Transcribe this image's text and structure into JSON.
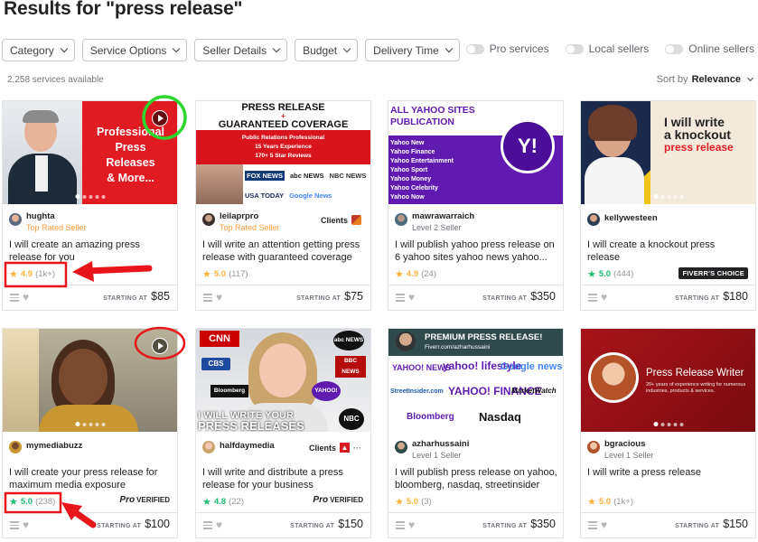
{
  "page": {
    "title": "Results for \"press release\""
  },
  "filters": [
    "Category",
    "Service Options",
    "Seller Details",
    "Budget",
    "Delivery Time"
  ],
  "toggles": [
    "Pro services",
    "Local sellers",
    "Online sellers"
  ],
  "results": {
    "count": "2,258 services available",
    "sort_label": "Sort by",
    "sort_value": "Relevance"
  },
  "footer": {
    "starting_label": "STARTING AT"
  },
  "cards": [
    {
      "seller": "hughta",
      "level": "Top Rated Seller",
      "title": "I will create an amazing press release for you",
      "score": "4.9",
      "reviews": "(1k+)",
      "price": "$85",
      "star": "gold",
      "badge": "",
      "thumb": {
        "line1": "Professional",
        "line2": "Press",
        "line3": "Releases",
        "line4": "& More..."
      }
    },
    {
      "seller": "leilaprpro",
      "level": "Top Rated Seller",
      "clients": "Clients",
      "title": "I will write an attention getting press release with guaranteed coverage",
      "score": "5.0",
      "reviews": "(117)",
      "price": "$75",
      "star": "gold",
      "badge": "",
      "thumb": {
        "line1": "PRESS RELEASE",
        "line2": "GUARANTEED COVERAGE",
        "line3": "Public Relations Professional",
        "line4": "15 Years Experience",
        "line5": "170+ 5 Star Reviews",
        "logos": [
          "FOX NEWS",
          "abc NEWS",
          "NBC NEWS",
          "USA TODAY",
          "Google News"
        ]
      }
    },
    {
      "seller": "mawrawarraich",
      "level": "Level 2 Seller",
      "title": "I will publish yahoo press release on 6 yahoo sites yahoo news yahoo...",
      "score": "4.9",
      "reviews": "(24)",
      "price": "$350",
      "star": "gold",
      "badge": "",
      "thumb": {
        "line1": "ALL YAHOO SITES",
        "line2": "PUBLICATION",
        "list": [
          "Yahoo New",
          "Yahoo Finance",
          "Yahoo Entertainment",
          "Yahoo Sport",
          "Yahoo Money",
          "Yahoo Celebrity",
          "Yahoo Now"
        ],
        "logo": "Y!"
      }
    },
    {
      "seller": "kellywesteen",
      "level": "",
      "title": "I will create a knockout press release",
      "score": "5.0",
      "reviews": "(444)",
      "price": "$180",
      "star": "teal",
      "badge": "FIVERR'S CHOICE",
      "thumb": {
        "line1": "I will write",
        "line2": "a knockout",
        "line3": "press release"
      }
    },
    {
      "seller": "mymediabuzz",
      "level": "",
      "title": "I will create your press release for maximum media exposure",
      "score": "5.0",
      "reviews": "(238)",
      "price": "$100",
      "star": "teal",
      "badge": "Pro VERIFIED",
      "badge_pro": "Pro",
      "badge_verified": "VERIFIED",
      "thumb": {}
    },
    {
      "seller": "halfdaymedia",
      "level": "",
      "clients": "Clients",
      "title": "I will write and distribute a press release for your business",
      "score": "4.8",
      "reviews": "(22)",
      "price": "$150",
      "star": "teal",
      "badge": "Pro VERIFIED",
      "badge_pro": "Pro",
      "badge_verified": "VERIFIED",
      "thumb": {
        "line1": "I WILL WRITE YOUR",
        "line2": "PRESS RELEASES",
        "logos": [
          "CNN",
          "abc NEWS",
          "CBS",
          "BBC NEWS",
          "Bloomberg",
          "YAHOO!",
          "NBC"
        ]
      }
    },
    {
      "seller": "azharhussaini",
      "level": "Level 1 Seller",
      "title": "I will publish press release on yahoo, bloomberg, nasdaq, streetinsider",
      "score": "5.0",
      "reviews": "(3)",
      "price": "$350",
      "star": "gold",
      "badge": "",
      "thumb": {
        "line1": "PREMIUM PRESS RELEASE!",
        "line2": "Fiverr.com/azharhussaini",
        "logos": [
          "YAHOO! NEWS",
          "yahoo! lifestyle",
          "Google news",
          "StreetInsider.com",
          "YAHOO! FINANCE",
          "MarketWatch",
          "Bloomberg",
          "Nasdaq"
        ]
      }
    },
    {
      "seller": "bgracious",
      "level": "Level 1 Seller",
      "title": "I will write a press release",
      "score": "5.0",
      "reviews": "(1k+)",
      "price": "$150",
      "star": "gold",
      "badge": "",
      "thumb": {
        "line1": "Press Release Writer",
        "line2": "20+ years of experience writing for numerous industries, products & services."
      }
    }
  ],
  "colors": {
    "accent_green": "#1dbf73",
    "star_gold": "#ffb33e",
    "annotation_red": "#e8151b",
    "annotation_green": "#2dd62d"
  }
}
